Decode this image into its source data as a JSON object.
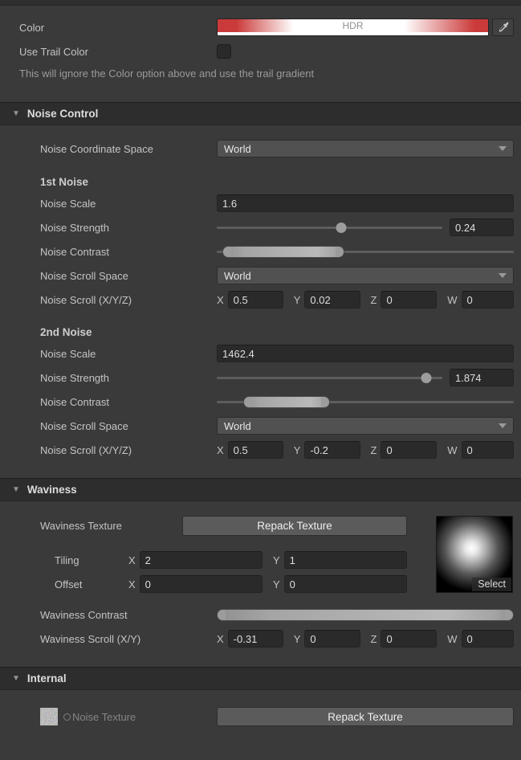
{
  "axes": {
    "x": "X",
    "y": "Y",
    "z": "Z",
    "w": "W"
  },
  "colors": {
    "hdr_red": "#cb3a3a",
    "alpha_white": "#ffffff"
  },
  "top": {
    "color_label": "Color",
    "hdr_label": "HDR",
    "color_gradient_css": "linear-gradient(90deg, #cb3a3a 0%, #cb3a3a 7%, #ffffff 28%, #ffffff 69%, #cb3a3a 95%, #cb3a3a 100%)",
    "use_trail_color_label": "Use Trail Color",
    "use_trail_color_checked": false,
    "help_text": "This will ignore the Color option above and use the trail gradient"
  },
  "noise_control": {
    "title": "Noise Control",
    "coordinate_space": {
      "label": "Noise Coordinate Space",
      "value": "World"
    },
    "first": {
      "title": "1st Noise",
      "scale": {
        "label": "Noise Scale",
        "value": "1.6"
      },
      "strength": {
        "label": "Noise Strength",
        "value": "0.24",
        "handle_percent": 55
      },
      "contrast": {
        "label": "Noise Contrast",
        "min_percent": 2,
        "max_percent": 43,
        "span_percent": 41
      },
      "scroll_space": {
        "label": "Noise Scroll Space",
        "value": "World"
      },
      "scroll": {
        "label": "Noise Scroll (X/Y/Z)",
        "x": "0.5",
        "y": "0.02",
        "z": "0",
        "w": "0"
      }
    },
    "second": {
      "title": "2nd Noise",
      "scale": {
        "label": "Noise Scale",
        "value": "1462.4"
      },
      "strength": {
        "label": "Noise Strength",
        "value": "1.874",
        "handle_percent": 93
      },
      "contrast": {
        "label": "Noise Contrast",
        "min_percent": 9,
        "max_percent": 38,
        "span_percent": 29
      },
      "scroll_space": {
        "label": "Noise Scroll Space",
        "value": "World"
      },
      "scroll": {
        "label": "Noise Scroll (X/Y/Z)",
        "x": "0.5",
        "y": "-0.2",
        "z": "0",
        "w": "0"
      }
    }
  },
  "waviness": {
    "title": "Waviness",
    "texture_label": "Waviness Texture",
    "repack_button": "Repack Texture",
    "select_label": "Select",
    "tiling": {
      "label": "Tiling",
      "x": "2",
      "y": "1"
    },
    "offset": {
      "label": "Offset",
      "x": "0",
      "y": "0"
    },
    "contrast": {
      "label": "Waviness Contrast",
      "min_percent": 0,
      "max_percent": 100,
      "span_percent": 100
    },
    "scroll": {
      "label": "Waviness Scroll (X/Y)",
      "x": "-0.31",
      "y": "0",
      "z": "0",
      "w": "0"
    }
  },
  "internal": {
    "title": "Internal",
    "noise_texture_label": "Noise Texture",
    "repack_button": "Repack Texture"
  }
}
